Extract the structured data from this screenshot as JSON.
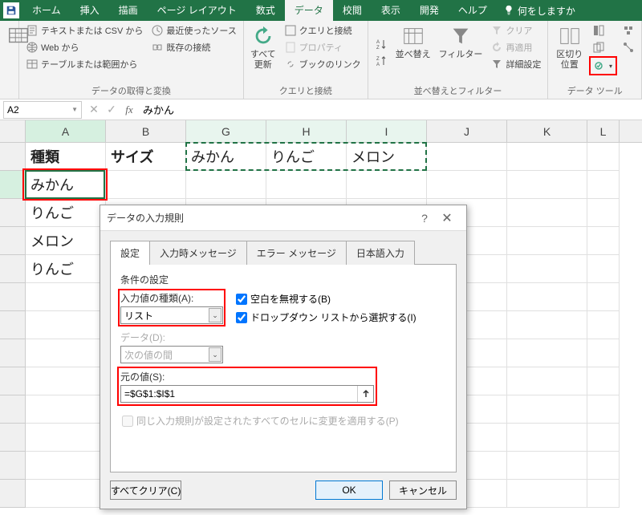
{
  "tabs": {
    "home": "ホーム",
    "insert": "挿入",
    "draw": "描画",
    "pagelayout": "ページ レイアウト",
    "formulas": "数式",
    "data": "データ",
    "review": "校閲",
    "view": "表示",
    "developer": "開発",
    "help": "ヘルプ",
    "tellme": "何をしますか"
  },
  "ribbon": {
    "get_transform": {
      "from_text_csv": "テキストまたは CSV から",
      "from_web": "Web から",
      "from_table_range": "テーブルまたは範囲から",
      "recent_sources": "最近使ったソース",
      "existing_conn": "既存の接続",
      "label": "データの取得と変換"
    },
    "queries_conn": {
      "refresh_all": "すべて\n更新",
      "queries_conn": "クエリと接続",
      "properties": "プロパティ",
      "edit_links": "ブックのリンク",
      "label": "クエリと接続"
    },
    "sort_filter": {
      "sort": "並べ替え",
      "filter": "フィルター",
      "clear": "クリア",
      "reapply": "再適用",
      "advanced": "詳細設定",
      "label": "並べ替えとフィルター"
    },
    "data_tools": {
      "text_to_cols": "区切り位置",
      "label": "データ ツール"
    }
  },
  "formula_bar": {
    "name_box": "A2",
    "formula": "みかん"
  },
  "grid": {
    "cols": [
      "A",
      "B",
      "G",
      "H",
      "I",
      "J",
      "K",
      "L"
    ],
    "cells": {
      "A1": "種類",
      "B1": "サイズ",
      "G1": "みかん",
      "H1": "りんご",
      "I1": "メロン",
      "A2": "みかん",
      "A3": "りんご",
      "A4": "メロン",
      "A5": "りんご"
    }
  },
  "dialog": {
    "title": "データの入力規則",
    "tabs": {
      "settings": "設定",
      "input_msg": "入力時メッセージ",
      "error_alert": "エラー メッセージ",
      "ime": "日本語入力"
    },
    "section": "条件の設定",
    "allow_label": "入力値の種類(A):",
    "allow_value": "リスト",
    "ignore_blank": "空白を無視する(B)",
    "dropdown_check": "ドロップダウン リストから選択する(I)",
    "data_label": "データ(D):",
    "data_value": "次の値の間",
    "source_label": "元の値(S):",
    "source_value": "=$G$1:$I$1",
    "apply_all": "同じ入力規則が設定されたすべてのセルに変更を適用する(P)",
    "clear_all": "すべてクリア(C)",
    "ok": "OK",
    "cancel": "キャンセル"
  }
}
